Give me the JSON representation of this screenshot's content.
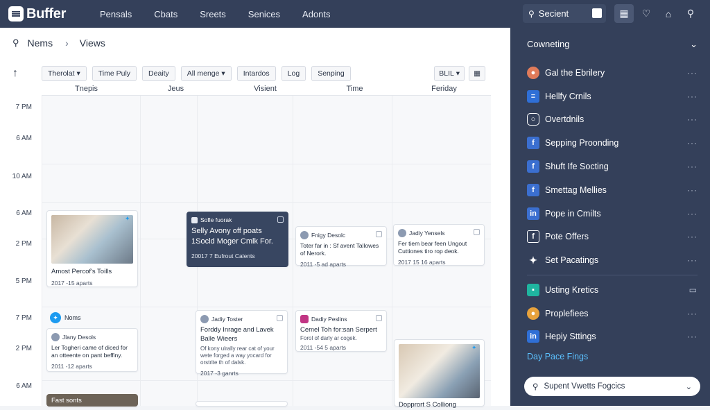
{
  "app": {
    "logo": "Buffer"
  },
  "topnav": [
    {
      "label": "Pensals"
    },
    {
      "label": "Cbats"
    },
    {
      "label": "Sreets"
    },
    {
      "label": "Senices"
    },
    {
      "label": "Adonts"
    }
  ],
  "topsearch": {
    "label": "Secient"
  },
  "breadcrumb": {
    "first": "Nems",
    "second": "Views"
  },
  "toolbar": {
    "chips": [
      "Therolat",
      "Time Puly",
      "Deaity",
      "All menge",
      "Intardos",
      "Log",
      "Senping"
    ],
    "right_chip": "BLIL"
  },
  "days": [
    "Tnepis",
    "Jeus",
    "Visient",
    "Time",
    "Feriday"
  ],
  "times": [
    "7 PM",
    "6 AM",
    "10 AM",
    "6 AM",
    "2 PM",
    "5 PM",
    "7 PM",
    "2 PM",
    "6 AM"
  ],
  "cards": {
    "c1": {
      "title": "Amost Percof's Toills",
      "meta": "2017 -15 aparts"
    },
    "c2": {
      "head": "Sofle fuorak",
      "title": "Selly Avony off poats 1Socld Moger Cmlk For.",
      "meta": "20017 7 Eufrout Calents"
    },
    "c3": {
      "name": "Fnigy Desolc",
      "title": "Toter far in : Sf avent Tallowes of Nerork.",
      "meta": "2011 -5 ad aparts"
    },
    "c4": {
      "name": "Jadiy Yensels",
      "title": "Fer tiem bear feen Ungout Cuttiones tiro rop deok.",
      "meta": "2017 15 16 aparts"
    },
    "c5": {
      "name": "Noms"
    },
    "c6": {
      "name": "Jlany Desols",
      "title": "Ler Togheri came of diced for an otteente on pant beffiny.",
      "meta": "2011 -12 aparts"
    },
    "c7": {
      "name": "Jadiy Toster",
      "title": "Forddy Inrage and Lavek Balle Wieers",
      "body": "Of kony ulrally rear cat of your wete forged a way yocard for orstrite th of dalsk.",
      "meta": "2017 -3 ganrts"
    },
    "c8": {
      "name": "Dadiy Peslins",
      "title": "Cemel Toh for:san Serpert",
      "body": "Forol of darly ar cogek.",
      "meta": "2011 -54 5 aparts"
    },
    "c9": {
      "title": "Dopprort S Colliong"
    },
    "c10": {
      "title": "Fast sonts"
    }
  },
  "sidebar": {
    "header": "Cowneting",
    "items": [
      {
        "label": "Gal the Ebrilery",
        "icon": "globe-icon",
        "color": "#e07b5a"
      },
      {
        "label": "Hellfy Crnils",
        "icon": "buffer-icon",
        "color": "#2f6fd6"
      },
      {
        "label": "Overtdnils",
        "icon": "instagram-icon",
        "color": "#34405a"
      },
      {
        "label": "Sepping Proonding",
        "icon": "facebook-icon",
        "color": "#3b6fd0"
      },
      {
        "label": "Shuft Ife Socting",
        "icon": "facebook-icon",
        "color": "#3b6fd0"
      },
      {
        "label": "Smettag Mellies",
        "icon": "facebook-icon",
        "color": "#3b6fd0"
      },
      {
        "label": "Pope in Cmilts",
        "icon": "linkedin-icon",
        "color": "#3b6fd0"
      },
      {
        "label": "Pote Offers",
        "icon": "facebook-icon",
        "color": "#34405a"
      },
      {
        "label": "Set Pacatings",
        "icon": "twitter-icon",
        "color": "#34405a"
      }
    ],
    "items2": [
      {
        "label": "Usting Kretics",
        "icon": "chart-icon",
        "color": "#1fb5a0"
      },
      {
        "label": "Proplefiees",
        "icon": "chrome-icon",
        "color": "#e8a23c"
      },
      {
        "label": "Hepiy Sttings",
        "icon": "linkedin-icon",
        "color": "#2f6fd6"
      }
    ],
    "link": "Day Pace Fings",
    "search": "Supent Vwetts Fogcics"
  }
}
